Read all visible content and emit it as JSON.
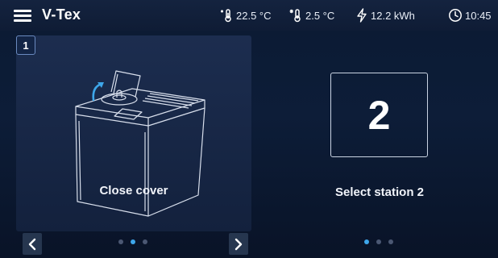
{
  "app": {
    "title": "V-Tex"
  },
  "status": {
    "inside_temperature": "22.5 °C",
    "outside_temperature": "2.5 °C",
    "energy": "12.2 kWh",
    "time": "10:45"
  },
  "left_card": {
    "step_number": "1",
    "instruction": "Close cover",
    "pager": {
      "total": 3,
      "active": 2
    }
  },
  "right_card": {
    "station_number": "2",
    "instruction": "Select station 2",
    "pager": {
      "total": 3,
      "active": 1
    }
  },
  "icons": {
    "menu": "hamburger-icon",
    "inside_temp": "thermometer-icon",
    "outside_temp": "thermometer-snow-icon",
    "energy": "lightning-icon",
    "clock": "clock-icon",
    "prev": "chevron-left-icon",
    "next": "chevron-right-icon"
  },
  "colors": {
    "background": "#0d1d38",
    "accent": "#3ea7ea",
    "card": "#1c2d4f"
  }
}
